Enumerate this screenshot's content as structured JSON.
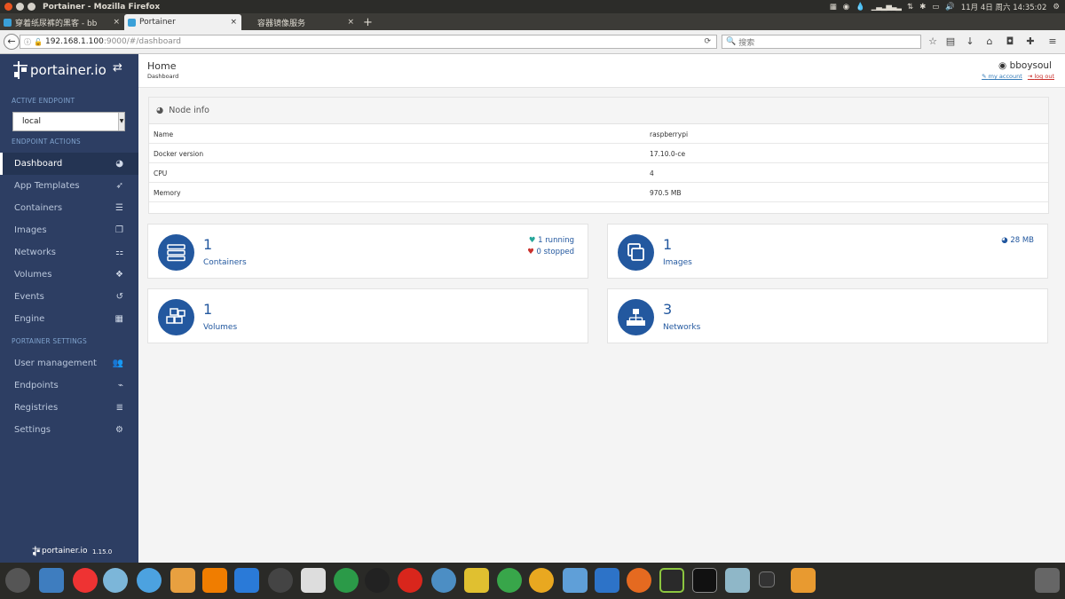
{
  "window": {
    "title": "Portainer - Mozilla Firefox",
    "tray_datetime": "11月 4日 周六 14:35:02"
  },
  "tabs": [
    {
      "label": "穿着纸尿裤的黑客 - bb",
      "active": false
    },
    {
      "label": "Portainer",
      "active": true
    },
    {
      "label": "容器镜像服务",
      "active": false
    }
  ],
  "navbar": {
    "url_host": "192.168.1.100",
    "url_rest": ":9000/#/dashboard",
    "search_placeholder": "搜索"
  },
  "sidebar": {
    "brand": "portainer.io",
    "active_endpoint_heading": "ACTIVE ENDPOINT",
    "endpoint_value": "local",
    "endpoint_actions_heading": "ENDPOINT ACTIONS",
    "items": [
      {
        "label": "Dashboard",
        "icon": "tachometer-icon",
        "active": true
      },
      {
        "label": "App Templates",
        "icon": "rocket-icon"
      },
      {
        "label": "Containers",
        "icon": "server-icon"
      },
      {
        "label": "Images",
        "icon": "clone-icon"
      },
      {
        "label": "Networks",
        "icon": "sitemap-icon"
      },
      {
        "label": "Volumes",
        "icon": "cubes-icon"
      },
      {
        "label": "Events",
        "icon": "history-icon"
      },
      {
        "label": "Engine",
        "icon": "th-icon"
      }
    ],
    "settings_heading": "PORTAINER SETTINGS",
    "settings_items": [
      {
        "label": "User management",
        "icon": "users-icon"
      },
      {
        "label": "Endpoints",
        "icon": "plug-icon"
      },
      {
        "label": "Registries",
        "icon": "database-icon"
      },
      {
        "label": "Settings",
        "icon": "cogs-icon"
      }
    ],
    "footer_brand": "portainer.io",
    "version": "1.15.0"
  },
  "header": {
    "title": "Home",
    "breadcrumb": "Dashboard",
    "username": "bboysoul",
    "my_account": "my account",
    "log_out": "log out"
  },
  "node_info": {
    "heading": "Node info",
    "rows": [
      {
        "key": "Name",
        "value": "raspberrypi"
      },
      {
        "key": "Docker version",
        "value": "17.10.0-ce"
      },
      {
        "key": "CPU",
        "value": "4"
      },
      {
        "key": "Memory",
        "value": "970.5 MB"
      }
    ]
  },
  "widgets": {
    "containers": {
      "count": "1",
      "label": "Containers",
      "running": "1 running",
      "stopped": "0 stopped"
    },
    "images": {
      "count": "1",
      "label": "Images",
      "size": "28 MB"
    },
    "volumes": {
      "count": "1",
      "label": "Volumes"
    },
    "networks": {
      "count": "3",
      "label": "Networks"
    }
  },
  "colors": {
    "sidebar_bg": "#2d3e63",
    "accent": "#23589f",
    "running": "#26a69a",
    "stopped": "#c9302c"
  }
}
